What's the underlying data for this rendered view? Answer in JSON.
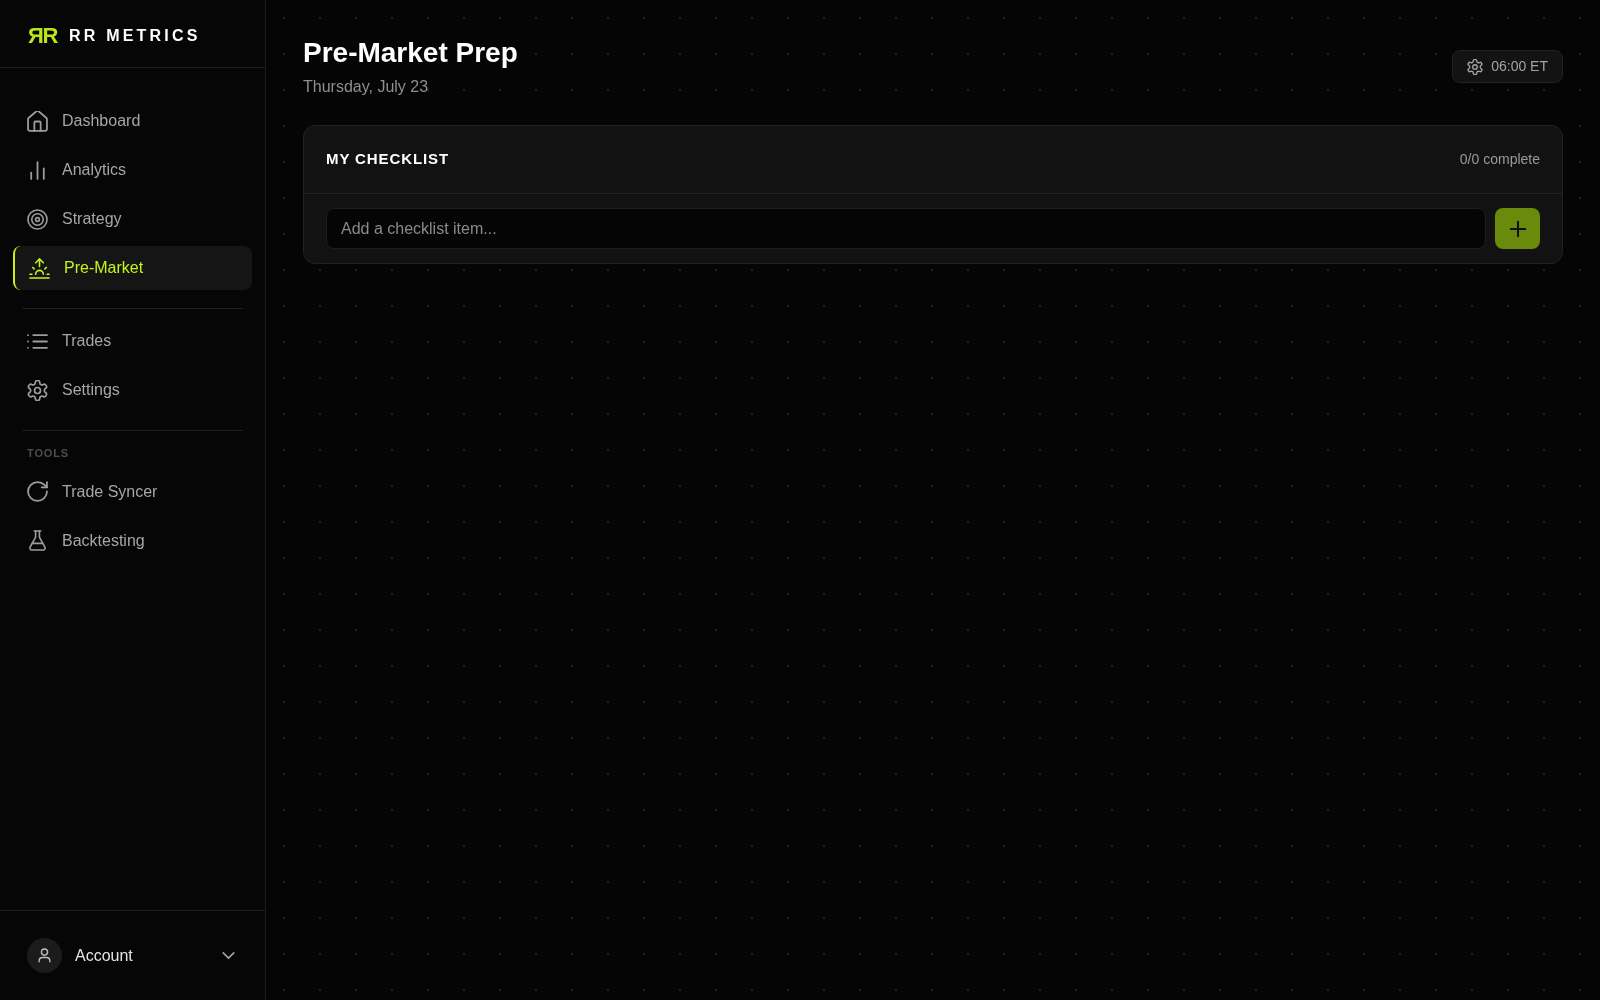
{
  "sidebar": {
    "brand": {
      "mark": "ЯR",
      "name": "RR METRICS"
    },
    "nav_groups": [
      {
        "items": [
          {
            "label": "Dashboard",
            "selected": false
          },
          {
            "label": "Analytics",
            "selected": false
          },
          {
            "label": "Strategy",
            "selected": false
          },
          {
            "label": "Pre-Market",
            "selected": true
          }
        ]
      },
      {
        "items": [
          {
            "label": "Trades",
            "selected": false
          },
          {
            "label": "Settings",
            "selected": false
          }
        ]
      },
      {
        "heading": "TOOLS",
        "items": [
          {
            "label": "Trade Syncer",
            "selected": false
          },
          {
            "label": "Backtesting",
            "selected": false
          }
        ]
      }
    ],
    "account": {
      "label": "Account"
    }
  },
  "header": {
    "title": "Pre-Market Prep",
    "date": "Thursday, July 23",
    "time_button": "06:00 ET"
  },
  "checklist": {
    "title": "MY CHECKLIST",
    "progress": "0/0 complete",
    "input": {
      "placeholder": "Add a checklist item..."
    }
  }
}
